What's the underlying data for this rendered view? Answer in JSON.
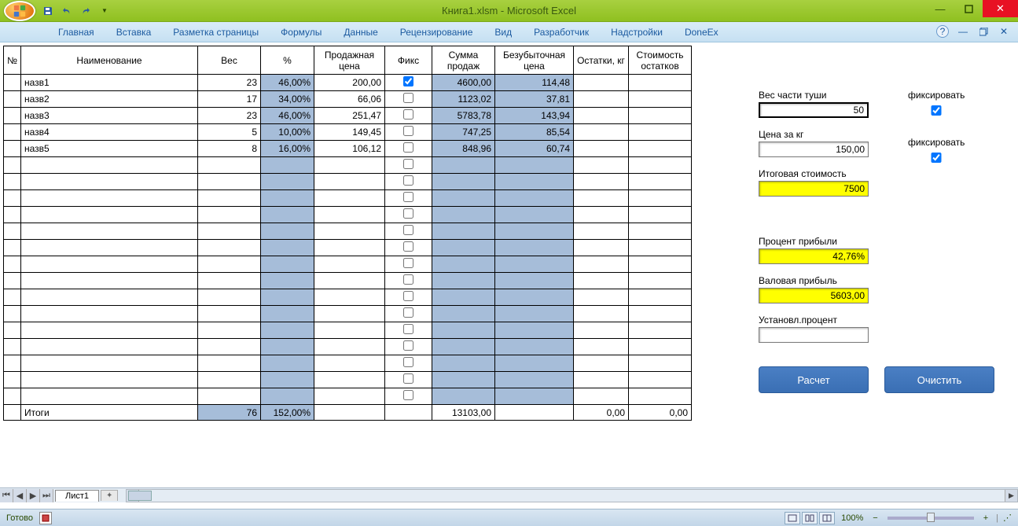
{
  "title": "Книга1.xlsm - Microsoft Excel",
  "ribbon": [
    "Главная",
    "Вставка",
    "Разметка страницы",
    "Формулы",
    "Данные",
    "Рецензирование",
    "Вид",
    "Разработчик",
    "Надстройки",
    "DoneEx"
  ],
  "headers": {
    "num": "№",
    "name": "Наименование",
    "weight": "Вес",
    "pct": "%",
    "price": "Продажная цена",
    "fix": "Фикс",
    "sum": "Сумма продаж",
    "breakeven": "Безубыточная цена",
    "rest": "Остатки, кг",
    "restcost": "Стоимость остатков"
  },
  "rows": [
    {
      "name": "назв1",
      "w": "23",
      "p": "46,00%",
      "price": "200,00",
      "chk": true,
      "sum": "4600,00",
      "be": "114,48"
    },
    {
      "name": "назв2",
      "w": "17",
      "p": "34,00%",
      "price": "66,06",
      "chk": false,
      "sum": "1123,02",
      "be": "37,81"
    },
    {
      "name": "назв3",
      "w": "23",
      "p": "46,00%",
      "price": "251,47",
      "chk": false,
      "sum": "5783,78",
      "be": "143,94"
    },
    {
      "name": "назв4",
      "w": "5",
      "p": "10,00%",
      "price": "149,45",
      "chk": false,
      "sum": "747,25",
      "be": "85,54"
    },
    {
      "name": "назв5",
      "w": "8",
      "p": "16,00%",
      "price": "106,12",
      "chk": false,
      "sum": "848,96",
      "be": "60,74"
    }
  ],
  "emptyRows": 15,
  "totals": {
    "label": "Итоги",
    "w": "76",
    "p": "152,00%",
    "sum": "13103,00",
    "rest": "0,00",
    "restcost": "0,00"
  },
  "side": {
    "weight_label": "Вес части туши",
    "weight_val": "50",
    "price_label": "Цена за кг",
    "price_val": "150,00",
    "total_label": "Итоговая стоимость",
    "total_val": "7500",
    "profitpct_label": "Процент прибыли",
    "profitpct_val": "42,76%",
    "gross_label": "Валовая прибыль",
    "gross_val": "5603,00",
    "setpct_label": "Установл.процент",
    "setpct_val": "",
    "fix_label": "фиксировать",
    "calc": "Расчет",
    "clear": "Очистить"
  },
  "sheet": {
    "tab": "Лист1"
  },
  "status": {
    "ready": "Готово",
    "zoom": "100%"
  }
}
